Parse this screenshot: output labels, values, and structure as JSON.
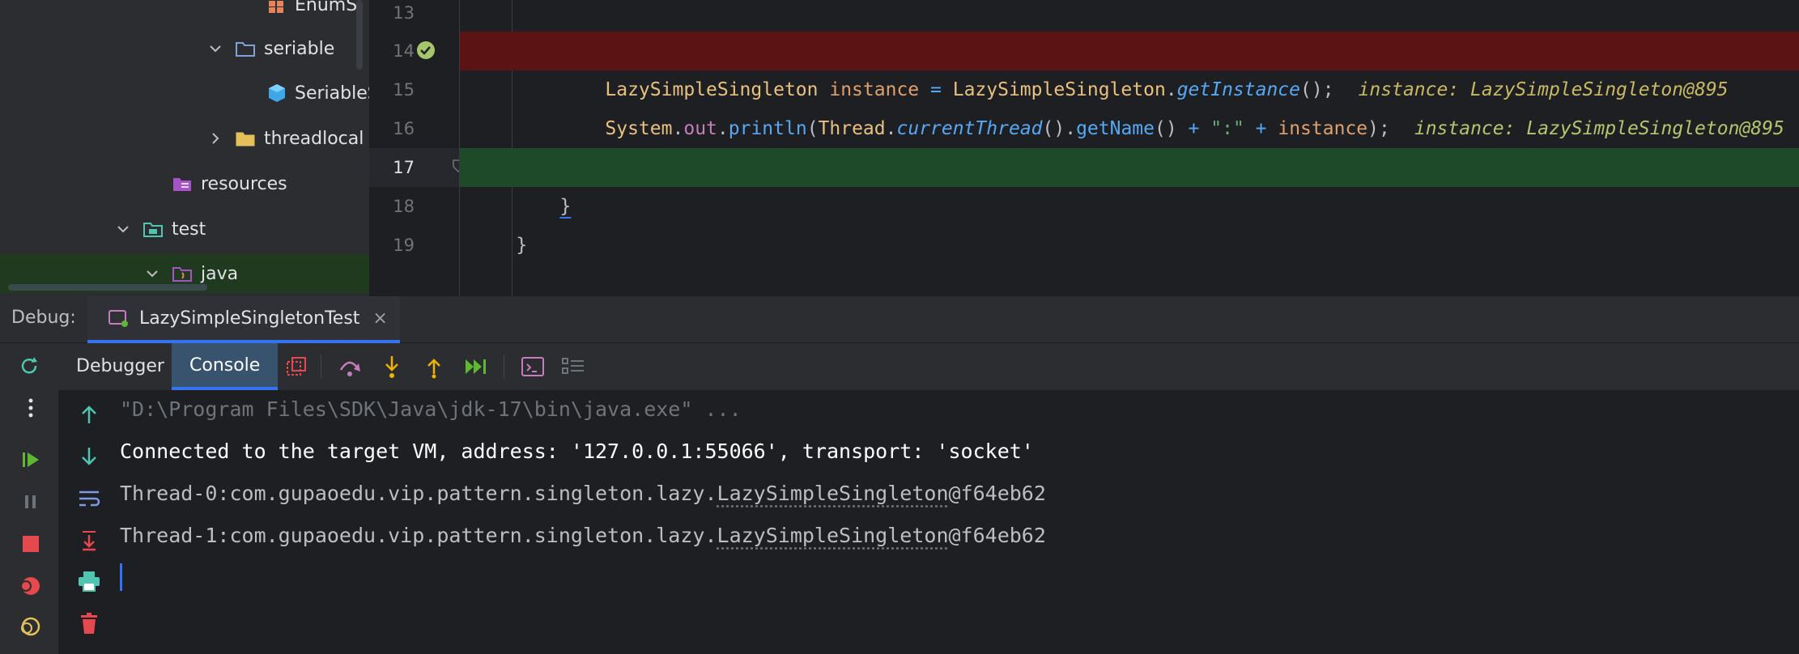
{
  "project_tree": {
    "items": [
      {
        "label": "EnumSi"
      },
      {
        "label": "seriable"
      },
      {
        "label": "SeriableS"
      },
      {
        "label": "threadlocal"
      },
      {
        "label": "resources"
      },
      {
        "label": "test"
      },
      {
        "label": "java"
      }
    ]
  },
  "editor": {
    "line_numbers": [
      "13",
      "14",
      "15",
      "16",
      "17",
      "18",
      "19"
    ],
    "line14": {
      "type": "LazySimpleSingleton",
      "var": "instance",
      "eq": "=",
      "cls": "LazySimpleSingleton",
      "dot": ".",
      "method": "getInstance",
      "tail": "();",
      "inlay": "instance: LazySimpleSingleton@895"
    },
    "line15": {
      "system": "System",
      "dot1": ".",
      "out": "out",
      "dot2": ".",
      "println": "println",
      "paren1": "(",
      "thread": "Thread",
      "dot3": ".",
      "current": "currentThread",
      "paren2": "().",
      "getname": "getName",
      "paren3": "() ",
      "plus1": "+",
      "str": " \":\" ",
      "plus2": "+",
      "inst": " instance",
      "end": ");",
      "inlay": "instance: LazySimpleSingleton@895"
    },
    "line17": "}",
    "line18": "}"
  },
  "debug": {
    "label": "Debug:",
    "tab_title": "LazySimpleSingletonTest",
    "close": "×",
    "tabs": {
      "debugger": "Debugger",
      "console": "Console"
    }
  },
  "console": {
    "lines": [
      "\"D:\\Program Files\\SDK\\Java\\jdk-17\\bin\\java.exe\" ...",
      "Connected to the target VM, address: '127.0.0.1:55066', transport: 'socket'"
    ],
    "thread0": {
      "prefix": "Thread-0:com.gupaoedu.vip.pattern.singleton.lazy.",
      "link": "LazySimpleSingleton",
      "suffix": "@f64eb62"
    },
    "thread1": {
      "prefix": "Thread-1:com.gupaoedu.vip.pattern.singleton.lazy.",
      "link": "LazySimpleSingleton",
      "suffix": "@f64eb62"
    }
  },
  "icons": {
    "rerun": "rerun-icon",
    "more": "more-vertical-icon",
    "resume": "resume-icon",
    "pause": "pause-icon",
    "stop": "stop-icon",
    "breakpoints": "view-breakpoints-icon",
    "mute": "mute-breakpoints-icon",
    "step_over": "step-over-icon",
    "step_into": "step-into-icon",
    "step_out": "step-out-icon",
    "run_to_cursor": "run-to-cursor-icon",
    "evaluate": "evaluate-icon",
    "layout": "layout-icon"
  },
  "colors": {
    "accent": "#3574f0",
    "breakpoint_line": "#5c1313",
    "execution_line": "#1e4a2a"
  }
}
